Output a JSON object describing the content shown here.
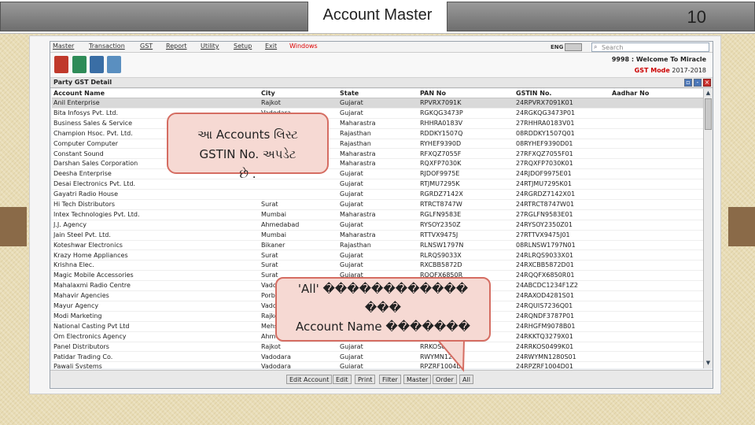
{
  "slide": {
    "title": "Account Master",
    "number": "10"
  },
  "menu": [
    {
      "label": "Master",
      "red": false
    },
    {
      "label": "Transaction",
      "red": false
    },
    {
      "label": "GST",
      "red": false
    },
    {
      "label": "Report",
      "red": false
    },
    {
      "label": "Utility",
      "red": false
    },
    {
      "label": "Setup",
      "red": false
    },
    {
      "label": "Exit",
      "red": false
    },
    {
      "label": "Windows",
      "red": true
    }
  ],
  "language": "ENG",
  "search": {
    "placeholder": "Search"
  },
  "company": {
    "line": "9998 : Welcome To Miracle",
    "mode_label": "GST Mode",
    "year": "2017-2018"
  },
  "grid": {
    "title": "Party GST Detail",
    "columns": [
      "Account Name",
      "City",
      "State",
      "PAN No",
      "GSTIN No.",
      "Aadhar No"
    ],
    "rows": [
      [
        "Anil Enterprise",
        "Rajkot",
        "Gujarat",
        "RPVRX7091K",
        "24RPVRX7091K01",
        ""
      ],
      [
        "Bita Infosys Pvt. Ltd.",
        "Vadodara",
        "Gujarat",
        "RGKQG3473P",
        "24RGKQG3473P01",
        ""
      ],
      [
        "Business Sales & Service",
        "",
        "Maharastra",
        "RHHRA0183V",
        "27RHHRA0183V01",
        ""
      ],
      [
        "Champion Hsoc. Pvt. Ltd.",
        "",
        "Rajasthan",
        "RDDKY1507Q",
        "08RDDKY1507Q01",
        ""
      ],
      [
        "Computer Computer",
        "",
        "Rajasthan",
        "RYHEF9390D",
        "08RYHEF9390D01",
        ""
      ],
      [
        "Constant Sound",
        "",
        "Maharastra",
        "RFXQZ7055F",
        "27RFXQZ7055F01",
        ""
      ],
      [
        "Darshan Sales Corporation",
        "",
        "Maharastra",
        "RQXFP7030K",
        "27RQXFP7030K01",
        ""
      ],
      [
        "Deesha Enterprise",
        "",
        "Gujarat",
        "RJDOF9975E",
        "24RJDOF9975E01",
        ""
      ],
      [
        "Desai Electronics Pvt. Ltd.",
        "",
        "Gujarat",
        "RTJMU7295K",
        "24RTJMU7295K01",
        ""
      ],
      [
        "Gayatri Radio House",
        "",
        "Gujarat",
        "RGRDZ7142X",
        "24RGRDZ7142X01",
        ""
      ],
      [
        "Hi Tech Distributors",
        "Surat",
        "Gujarat",
        "RTRCT8747W",
        "24RTRCT8747W01",
        ""
      ],
      [
        "Intex Technologies Pvt. Ltd.",
        "Mumbai",
        "Maharastra",
        "RGLFN9583E",
        "27RGLFN9583E01",
        ""
      ],
      [
        "J.J. Agency",
        "Ahmedabad",
        "Gujarat",
        "RYSOY2350Z",
        "24RYSOY2350Z01",
        ""
      ],
      [
        "Jain Steel Pvt. Ltd.",
        "Mumbai",
        "Maharastra",
        "RTTVX9475J",
        "27RTTVX9475J01",
        ""
      ],
      [
        "Koteshwar Electronics",
        "Bikaner",
        "Rajasthan",
        "RLNSW1797N",
        "08RLNSW1797N01",
        ""
      ],
      [
        "Krazy Home Appliances",
        "Surat",
        "Gujarat",
        "RLRQS9033X",
        "24RLRQS9033X01",
        ""
      ],
      [
        "Krishna Elec.",
        "Surat",
        "Gujarat",
        "RXCBB5872D",
        "24RXCBB5872D01",
        ""
      ],
      [
        "Magic Mobile Accessories",
        "Surat",
        "Gujarat",
        "RQQFX6850R",
        "24RQQFX6850R01",
        ""
      ],
      [
        "Mahalaxmi Radio Centre",
        "Vadodara",
        "Gujarat",
        "RCDCC1234F",
        "24ABCDC1234F1Z2",
        ""
      ],
      [
        "Mahavir Agencies",
        "Porbandar",
        "Gujarat",
        "RAXOD4281S",
        "24RAXOD4281S01",
        ""
      ],
      [
        "Mayur Agency",
        "Vadodara",
        "Gujarat",
        "RQUIS7236Q",
        "24RQUIS7236Q01",
        ""
      ],
      [
        "Modi Marketing",
        "Rajkot",
        "Gujarat",
        "RQNDF3787P",
        "24RQNDF3787P01",
        ""
      ],
      [
        "National Casting Pvt Ltd",
        "Mehsana",
        "Gujarat",
        "RHGFM9078B",
        "24RHGFM9078B01",
        ""
      ],
      [
        "Om Electronics Agency",
        "Ahmedabad",
        "Gujarat",
        "RKKTQ3279X",
        "24RKKTQ3279X01",
        ""
      ],
      [
        "Panel Distributors",
        "Rajkot",
        "Gujarat",
        "RRKOS0499K",
        "24RRKOS0499K01",
        ""
      ],
      [
        "Patidar Trading Co.",
        "Vadodara",
        "Gujarat",
        "RWYMN1280S",
        "24RWYMN1280S01",
        ""
      ],
      [
        "Pawali Systems",
        "Vadodara",
        "Gujarat",
        "RPZRF1004D",
        "24RPZRF1004D01",
        ""
      ]
    ]
  },
  "buttons": [
    "Edit Account",
    "Edit",
    "Print",
    "Filter",
    "Master",
    "Order",
    "All"
  ],
  "callout1": {
    "text": "આ Accounts લિસ્ટ\nGSTIN No. અપડેટ\nછે ."
  },
  "callout2": {
    "text": "'All' ������������\n���\nAccount Name �������"
  },
  "colors": {
    "accent": "#d56d62",
    "callout_bg": "#f6d9d3",
    "selected_row": "#d9d9d9"
  }
}
